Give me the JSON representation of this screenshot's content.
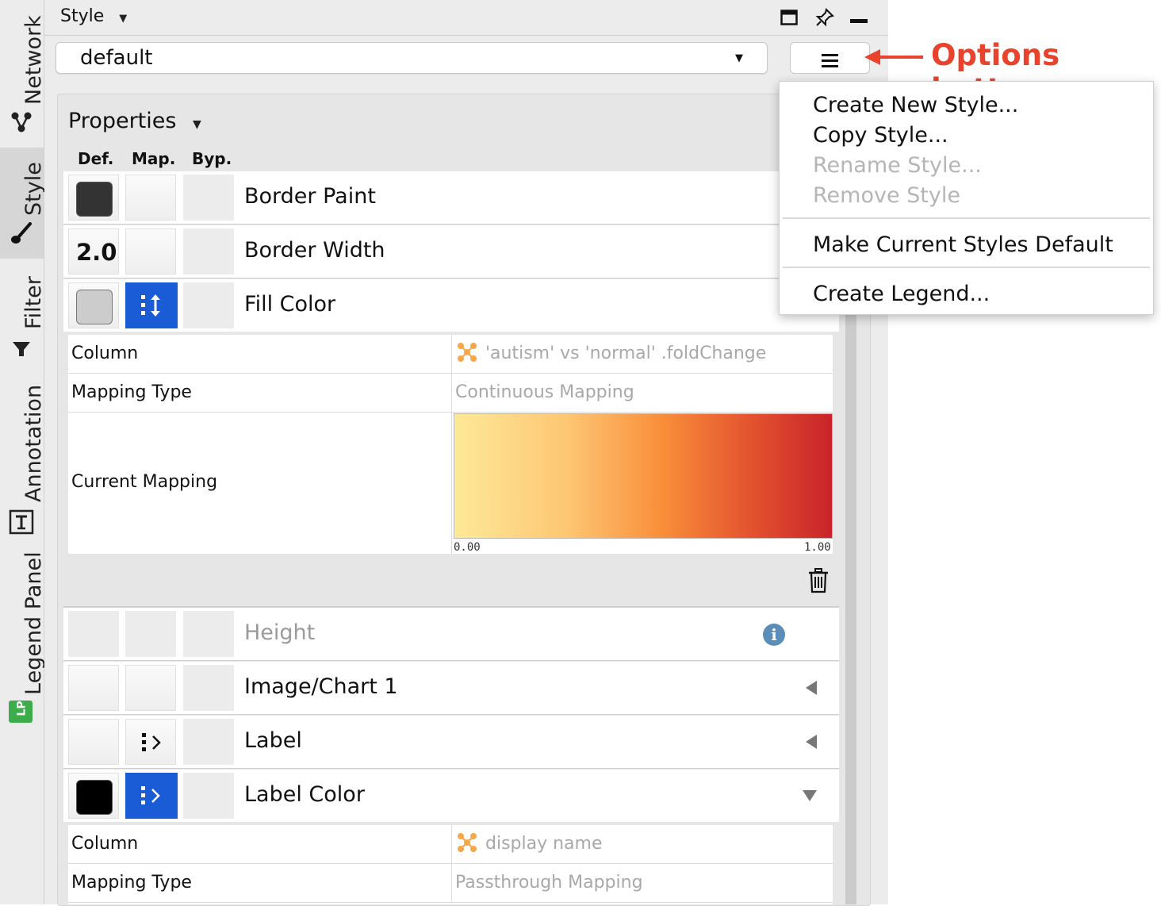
{
  "sidebar": {
    "tabs": [
      {
        "label": "Network",
        "icon": "network-icon",
        "active": false
      },
      {
        "label": "Style",
        "icon": "brush-icon",
        "active": true
      },
      {
        "label": "Filter",
        "icon": "filter-icon",
        "active": false
      },
      {
        "label": "Annotation",
        "icon": "annotation-icon",
        "active": false
      },
      {
        "label": "Legend Panel",
        "icon": "legend-panel-icon",
        "active": false
      }
    ],
    "legend_badge": "LP"
  },
  "panel": {
    "title": "Style",
    "window_icons": [
      "maximize-icon",
      "pin-icon",
      "minimize-icon"
    ]
  },
  "style_select": {
    "value": "default"
  },
  "options_button": {
    "icon": "hamburger-menu-icon"
  },
  "annotation": {
    "text": "Options button",
    "color": "#e8432d"
  },
  "properties": {
    "title": "Properties",
    "column_headers": [
      "Def.",
      "Map.",
      "Byp."
    ],
    "rows": [
      {
        "label": "Border Paint",
        "def_color": "#333333"
      },
      {
        "label": "Border Width",
        "def_value": "2.0"
      },
      {
        "label": "Fill Color",
        "def_color": "#cccccc",
        "mapped": true
      },
      {
        "label": "Height",
        "disabled": true
      },
      {
        "label": "Image/Chart 1"
      },
      {
        "label": "Label"
      },
      {
        "label": "Label Color",
        "def_color": "#000000",
        "mapped": true
      }
    ],
    "fill_mapping": {
      "rows": [
        {
          "label": "Column",
          "value": "'autism' vs 'normal' .foldChange"
        },
        {
          "label": "Mapping Type",
          "value": "Continuous Mapping"
        },
        {
          "label": "Current Mapping",
          "value": ""
        }
      ],
      "gradient_min": "0.00",
      "gradient_max": "1.00",
      "gradient_colors": [
        "#fde998",
        "#fdc673",
        "#f98e3a",
        "#e4542f",
        "#c9232a"
      ]
    },
    "label_color_mapping": {
      "rows": [
        {
          "label": "Column",
          "value": "display name"
        },
        {
          "label": "Mapping Type",
          "value": "Passthrough Mapping"
        }
      ]
    }
  },
  "menu": {
    "items": [
      {
        "label": "Create New Style...",
        "enabled": true
      },
      {
        "label": "Copy Style...",
        "enabled": true
      },
      {
        "label": "Rename Style...",
        "enabled": false
      },
      {
        "label": "Remove Style",
        "enabled": false
      },
      {
        "label": "Make Current Styles Default",
        "enabled": true
      },
      {
        "label": "Create Legend...",
        "enabled": true
      }
    ]
  },
  "colors": {
    "mapping_blue": "#1a5bd6",
    "accent_red": "#e8432d",
    "column_icon": "#f7a64a"
  }
}
